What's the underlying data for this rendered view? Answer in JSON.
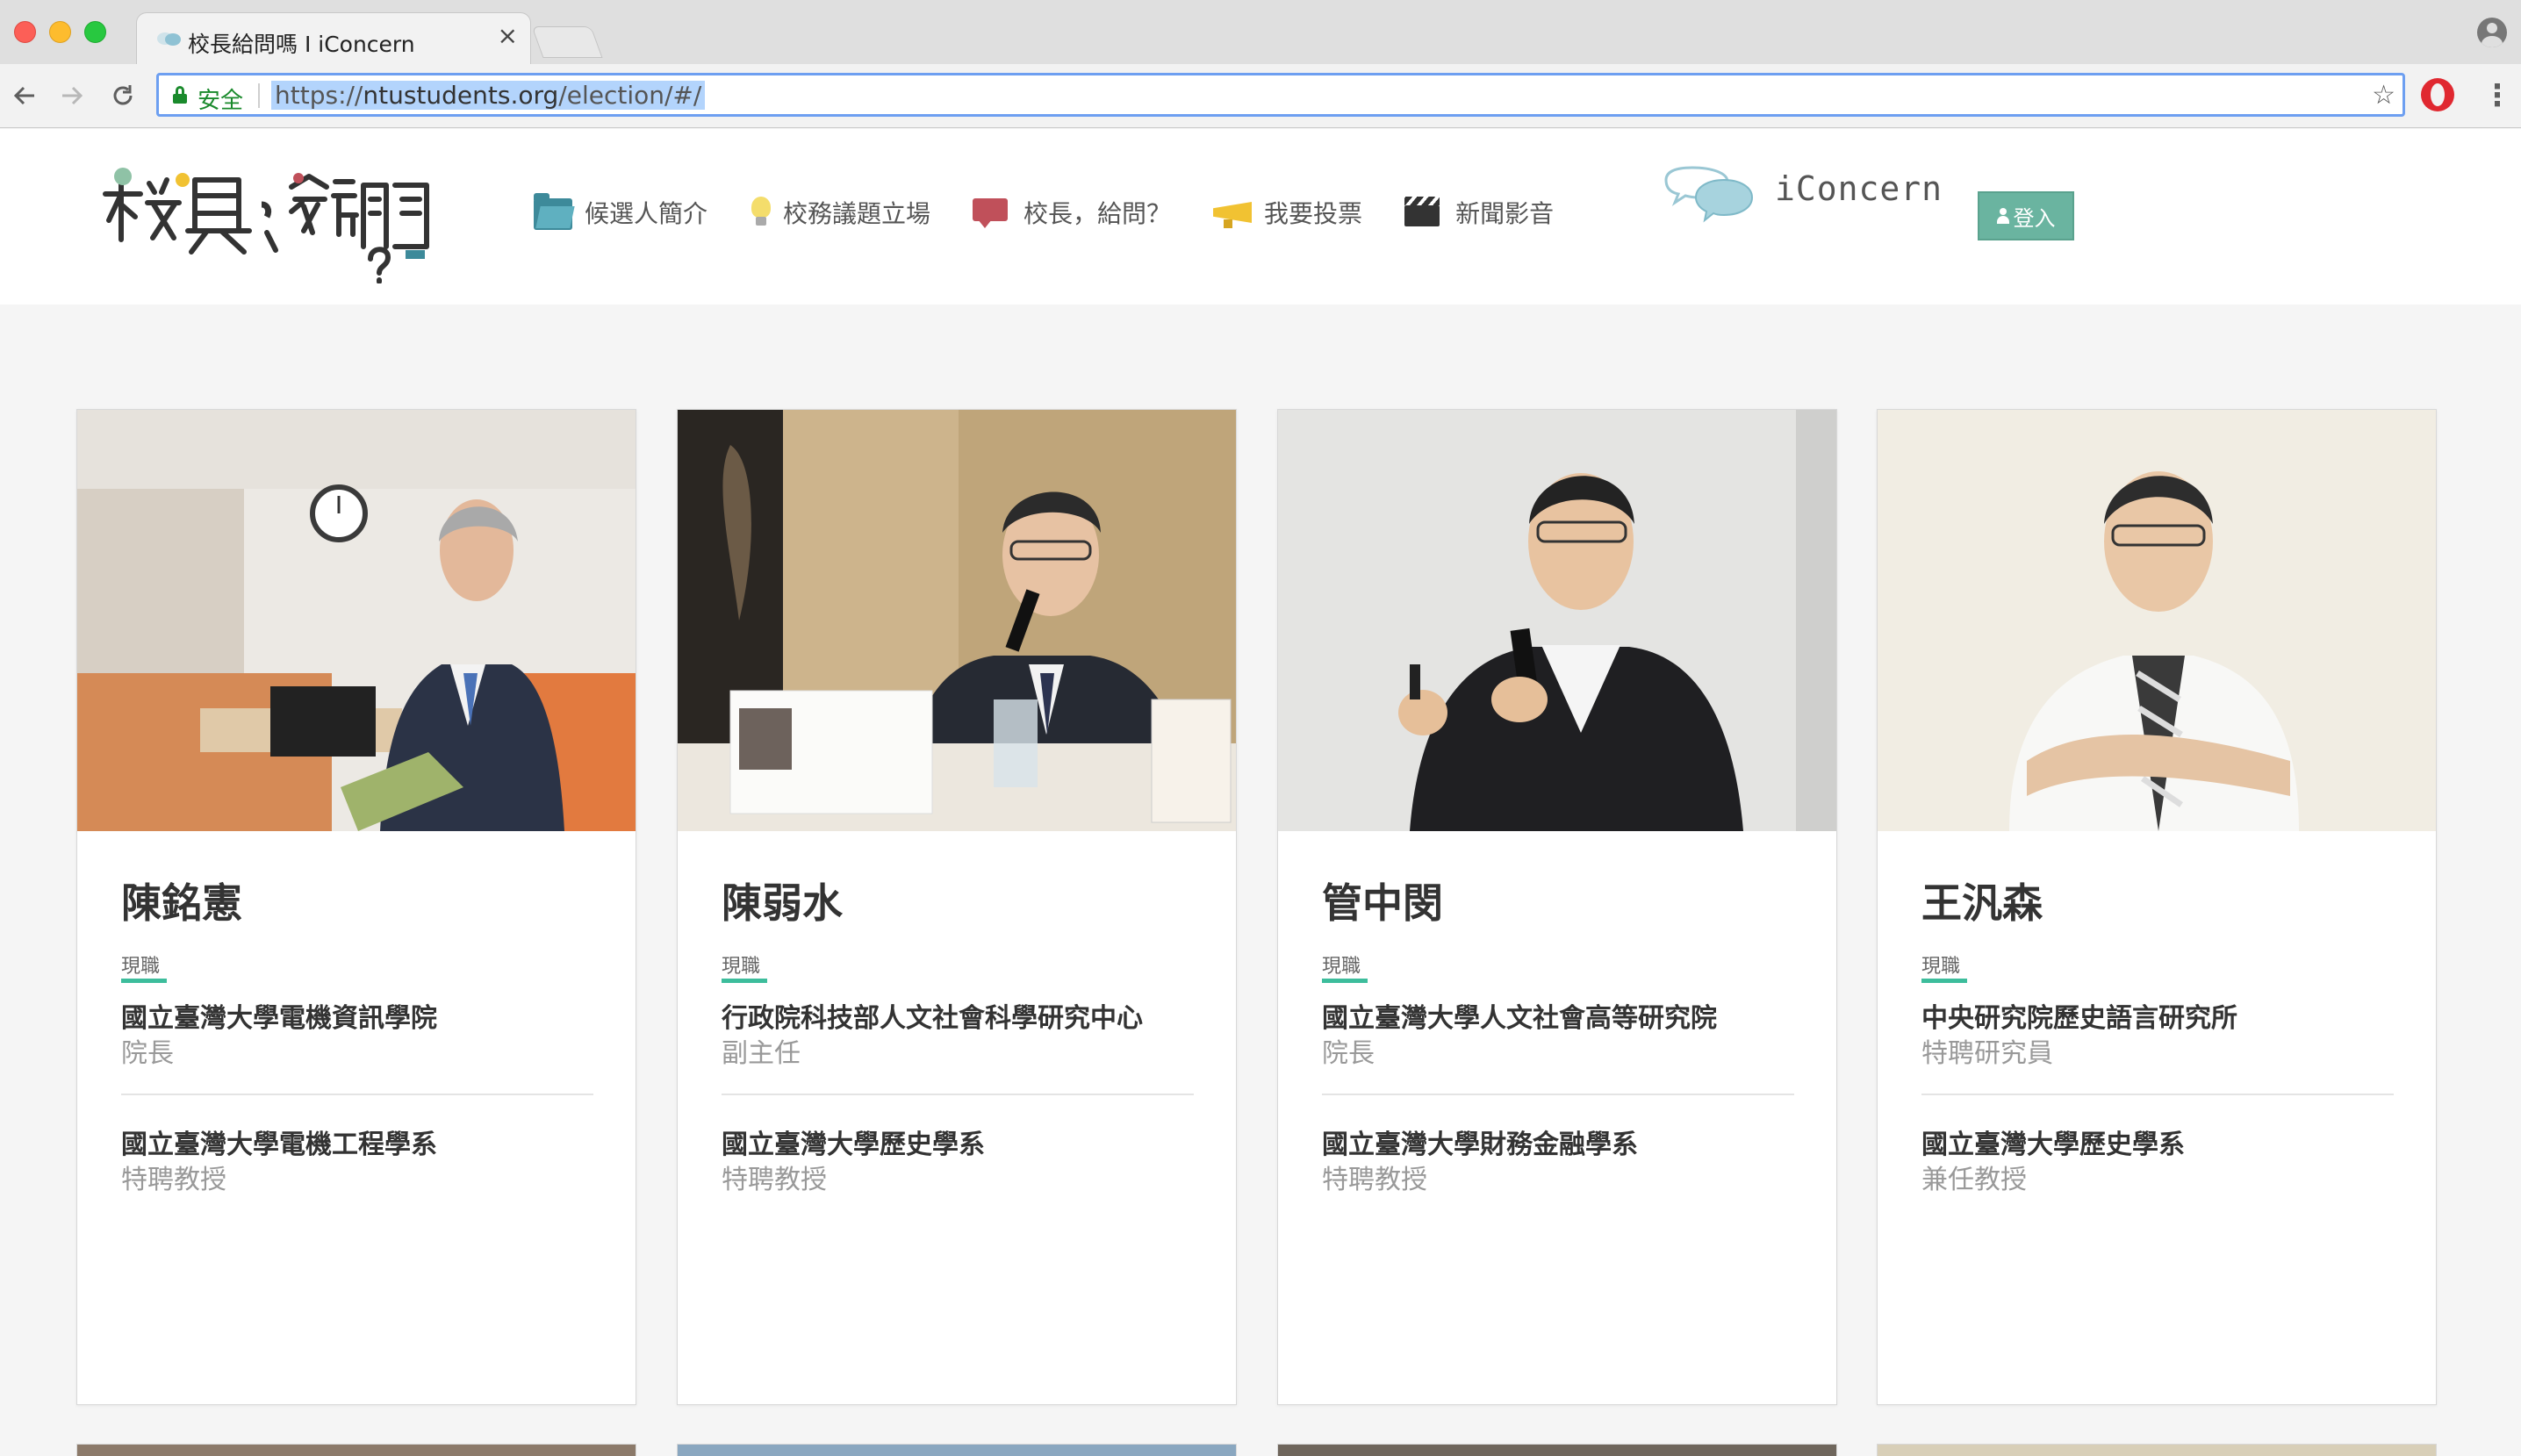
{
  "browser": {
    "tab_title": "校長給問嗎 I iConcern",
    "tab_close": "×",
    "secure_label": "安全",
    "url_scheme": "https://",
    "url_host": "ntustudents.org",
    "url_path": "/election/#/",
    "menu_glyph": "⋮",
    "star_glyph": "☆"
  },
  "site": {
    "logo_text": "校長，給問嗎?",
    "nav": [
      {
        "label": "候選人簡介",
        "icon": "folder-icon"
      },
      {
        "label": "校務議題立場",
        "icon": "lightbulb-icon"
      },
      {
        "label": "校長，給問？",
        "icon": "chat-icon"
      },
      {
        "label": "我要投票",
        "icon": "megaphone-icon"
      },
      {
        "label": "新聞影音",
        "icon": "clapperboard-icon"
      }
    ],
    "brand": "iConcern",
    "login_label": "登入"
  },
  "colors": {
    "accent": "#3dbd9c",
    "login_bg": "#6ab4a0",
    "secure_green": "#1a8a2c"
  },
  "candidates": [
    {
      "name": "陳銘憲",
      "current_label": "現職",
      "jobs": [
        {
          "org": "國立臺灣大學電機資訊學院",
          "title": "院長"
        },
        {
          "org": "國立臺灣大學電機工程學系",
          "title": "特聘教授"
        }
      ]
    },
    {
      "name": "陳弱水",
      "current_label": "現職",
      "jobs": [
        {
          "org": "行政院科技部人文社會科學研究中心",
          "title": "副主任"
        },
        {
          "org": "國立臺灣大學歷史學系",
          "title": "特聘教授"
        }
      ]
    },
    {
      "name": "管中閔",
      "current_label": "現職",
      "jobs": [
        {
          "org": "國立臺灣大學人文社會高等研究院",
          "title": "院長"
        },
        {
          "org": "國立臺灣大學財務金融學系",
          "title": "特聘教授"
        }
      ]
    },
    {
      "name": "王汎森",
      "current_label": "現職",
      "jobs": [
        {
          "org": "中央研究院歷史語言研究所",
          "title": "特聘研究員"
        },
        {
          "org": "國立臺灣大學歷史學系",
          "title": "兼任教授"
        }
      ]
    }
  ]
}
